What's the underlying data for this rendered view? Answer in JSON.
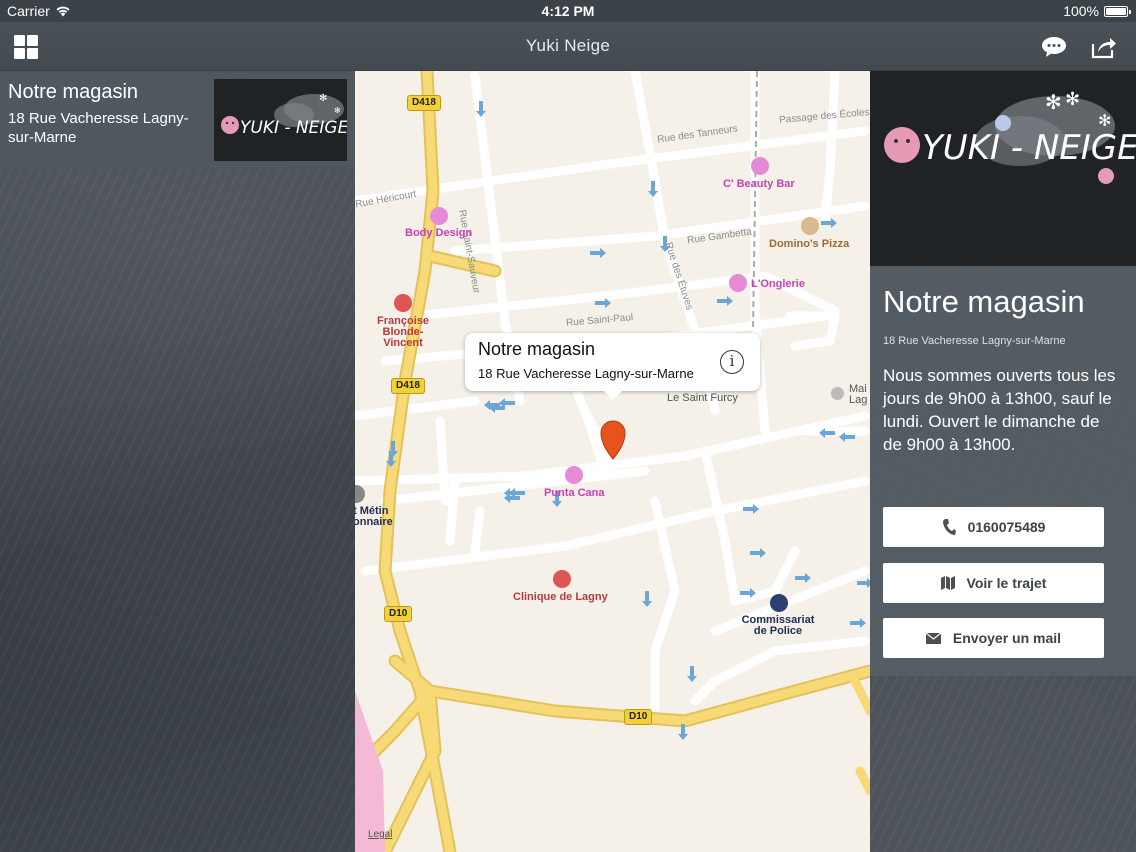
{
  "status_bar": {
    "carrier": "Carrier",
    "time": "4:12 PM",
    "battery": "100%",
    "battery_level": 1.0
  },
  "nav": {
    "title": "Yuki Neige",
    "icons": [
      "grid-icon",
      "chat-icon",
      "share-icon"
    ]
  },
  "list": {
    "items": [
      {
        "title": "Notre magasin",
        "address": "18 Rue Vacheresse Lagny-sur-Marne"
      }
    ]
  },
  "logo": {
    "text": "YUKI - NEIGE"
  },
  "map": {
    "callout": {
      "title": "Notre magasin",
      "address": "18 Rue Vacheresse Lagny-sur-Marne"
    },
    "streets": [
      "Rue des Tanneurs",
      "Passage des Écoles",
      "Rue Héricourt",
      "Rue Saint-Sauveur",
      "Rue Gambetta",
      "Rue des Étuves",
      "Rue Saint-Paul"
    ],
    "road_shields": [
      "D418",
      "D418",
      "D10",
      "D10"
    ],
    "pois": {
      "beauty_bar": "C' Beauty Bar",
      "body_design": "Body Design",
      "dominos": "Domino's Pizza",
      "onglerie": "L'Onglerie",
      "francoise": "Françoise Blonde-Vincent",
      "saint_furcy": "Le Saint Furcy",
      "punta_cana": "Punta Cana",
      "clinique": "Clinique de Lagny",
      "commissariat": "Commissariat de Police",
      "st_metin": "t Métin onnaire",
      "mai": "Mai Lag"
    },
    "legal": "Legal"
  },
  "detail": {
    "title": "Notre magasin",
    "address": "18 Rue Vacheresse Lagny-sur-Marne",
    "description": "Nous sommes ouverts tous les jours de 9h00 à 13h00, sauf le lundi.  Ouvert le dimanche de de 9h00 à 13h00.",
    "buttons": {
      "phone": "0160075489",
      "route": "Voir le trajet",
      "mail": "Envoyer un mail"
    }
  },
  "colors": {
    "pin": "#e8521d",
    "road_yellow": "#f6d86a",
    "panel": "#565e65"
  }
}
